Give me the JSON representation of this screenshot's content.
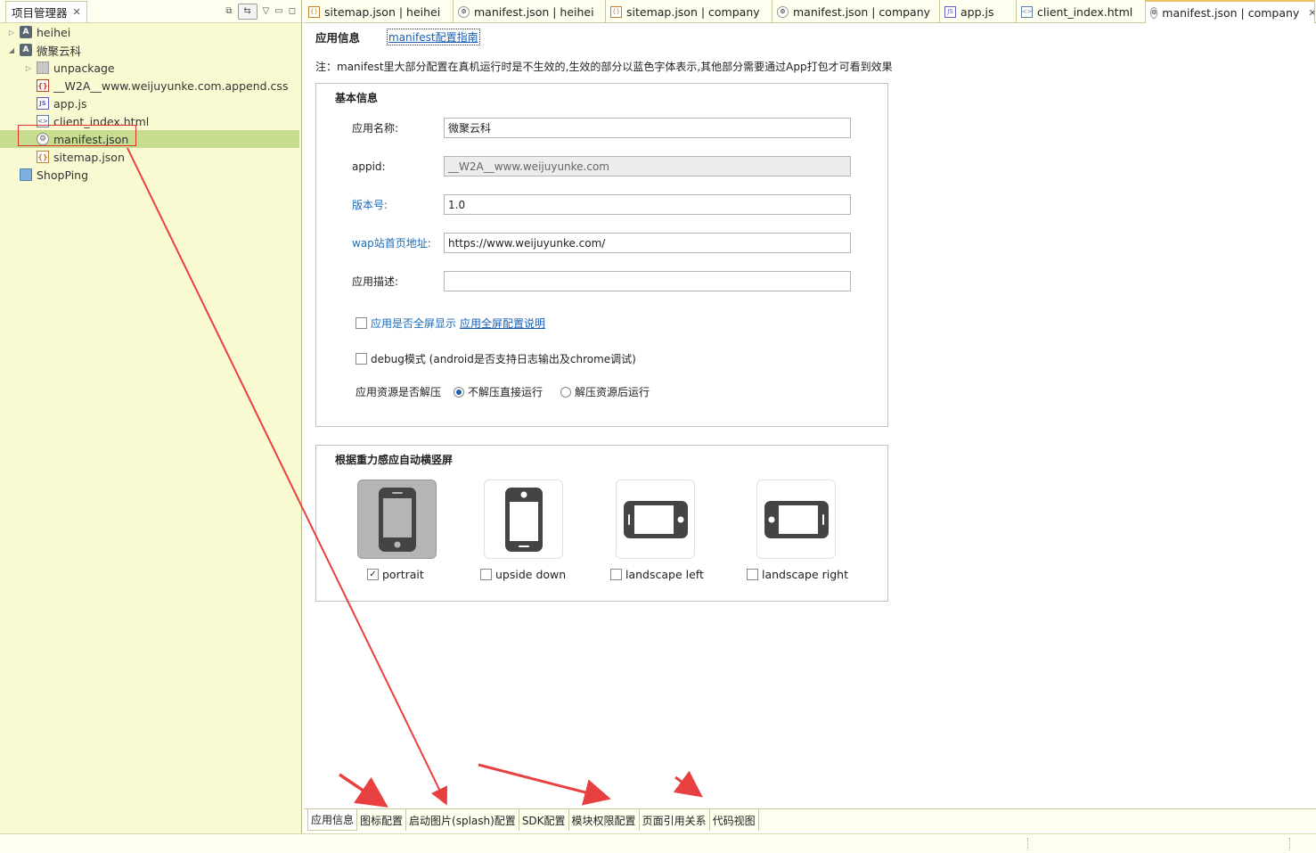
{
  "project_panel": {
    "tab_label": "项目管理器",
    "tree": [
      {
        "label": "heihei",
        "icon": "project-icon",
        "expanded": false
      },
      {
        "label": "微聚云科",
        "icon": "project-icon",
        "expanded": true
      },
      {
        "label": "unpackage",
        "icon": "package-icon",
        "expanded": false
      },
      {
        "label": "__W2A__www.weijuyunke.com.append.css",
        "icon": "css-file-icon"
      },
      {
        "label": "app.js",
        "icon": "js-file-icon"
      },
      {
        "label": "client_index.html",
        "icon": "html-file-icon"
      },
      {
        "label": "manifest.json",
        "icon": "gear-file-icon",
        "selected": true
      },
      {
        "label": "sitemap.json",
        "icon": "json-file-icon"
      },
      {
        "label": "ShopPing",
        "icon": "folder-icon"
      }
    ]
  },
  "editor_tabs": [
    {
      "label": "sitemap.json | heihei",
      "icon": "json-file-icon"
    },
    {
      "label": "manifest.json | heihei",
      "icon": "gear-file-icon"
    },
    {
      "label": "sitemap.json | company",
      "icon": "json-file-icon"
    },
    {
      "label": "manifest.json | company",
      "icon": "gear-file-icon"
    },
    {
      "label": "app.js",
      "icon": "js-file-icon"
    },
    {
      "label": "client_index.html",
      "icon": "html-file-icon"
    },
    {
      "label": "manifest.json | company",
      "icon": "gear-file-icon",
      "active": true
    }
  ],
  "subheader": {
    "title": "应用信息",
    "guide_link": "manifest配置指南"
  },
  "note": "注：manifest里大部分配置在真机运行时是不生效的,生效的部分以蓝色字体表示,其他部分需要通过App打包才可看到效果",
  "basic_info": {
    "title": "基本信息",
    "app_name_label": "应用名称:",
    "app_name_value": "微聚云科",
    "appid_label": "appid:",
    "appid_value": "__W2A__www.weijuyunke.com",
    "version_label": "版本号:",
    "version_value": "1.0",
    "wap_label": "wap站首页地址:",
    "wap_value": "https://www.weijuyunke.com/",
    "desc_label": "应用描述:",
    "desc_value": "",
    "fullscreen_label": "应用是否全屏显示",
    "fullscreen_link": "应用全屏配置说明",
    "debug_label": "debug模式 (android是否支持日志输出及chrome调试)",
    "unzip_label": "应用资源是否解压",
    "unzip_option_1": "不解压直接运行",
    "unzip_option_2": "解压资源后运行"
  },
  "orientation": {
    "title": "根据重力感应自动横竖屏",
    "options": [
      {
        "label": "portrait",
        "checked": true
      },
      {
        "label": "upside down",
        "checked": false
      },
      {
        "label": "landscape left",
        "checked": false
      },
      {
        "label": "landscape right",
        "checked": false
      }
    ]
  },
  "bottom_tabs": [
    "应用信息",
    "图标配置",
    "启动图片(splash)配置",
    "SDK配置",
    "模块权限配置",
    "页面引用关系",
    "代码视图"
  ],
  "colors": {
    "panel_bg": "#fafad2",
    "selected_row": "#c6dc8e",
    "link_blue": "#1a5fb4",
    "annotation_red": "#e84040"
  }
}
